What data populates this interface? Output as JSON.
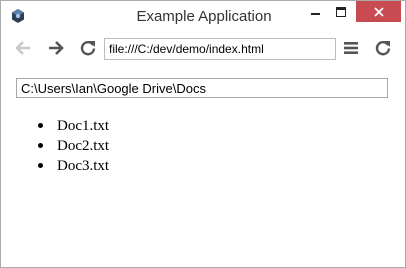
{
  "window": {
    "title": "Example Application"
  },
  "toolbar": {
    "back_icon": "arrow-left-icon",
    "forward_icon": "arrow-right-icon",
    "reload_icon": "reload-icon",
    "url": "file:///C:/dev/demo/index.html",
    "menu_icon": "hamburger-menu-icon",
    "refresh_icon": "refresh-icon"
  },
  "content": {
    "path_value": "C:\\Users\\Ian\\Google Drive\\Docs",
    "files": [
      "Doc1.txt",
      "Doc2.txt",
      "Doc3.txt"
    ]
  },
  "colors": {
    "close_button": "#c74b50",
    "icon_active": "#555555",
    "icon_disabled": "#c8c8c8"
  }
}
